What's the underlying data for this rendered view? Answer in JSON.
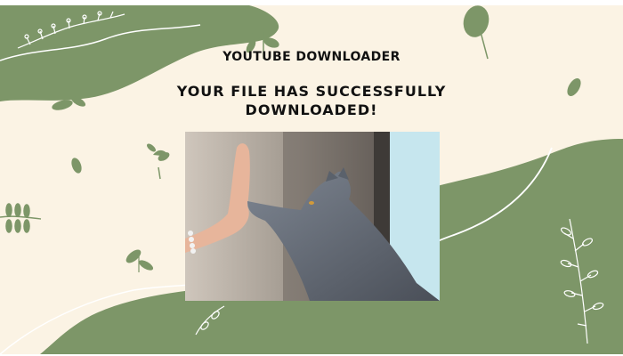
{
  "app": {
    "name": "YOUTUBE DOWNLOADER"
  },
  "message": {
    "headline": "YOUR FILE HAS SUCCESSFULLY DOWNLOADED!"
  },
  "image": {
    "subject": "high-five-cat-photo"
  },
  "colors": {
    "background": "#fbf3e4",
    "accent_green": "#7d9668",
    "line_white": "#ffffff",
    "text": "#111111"
  }
}
